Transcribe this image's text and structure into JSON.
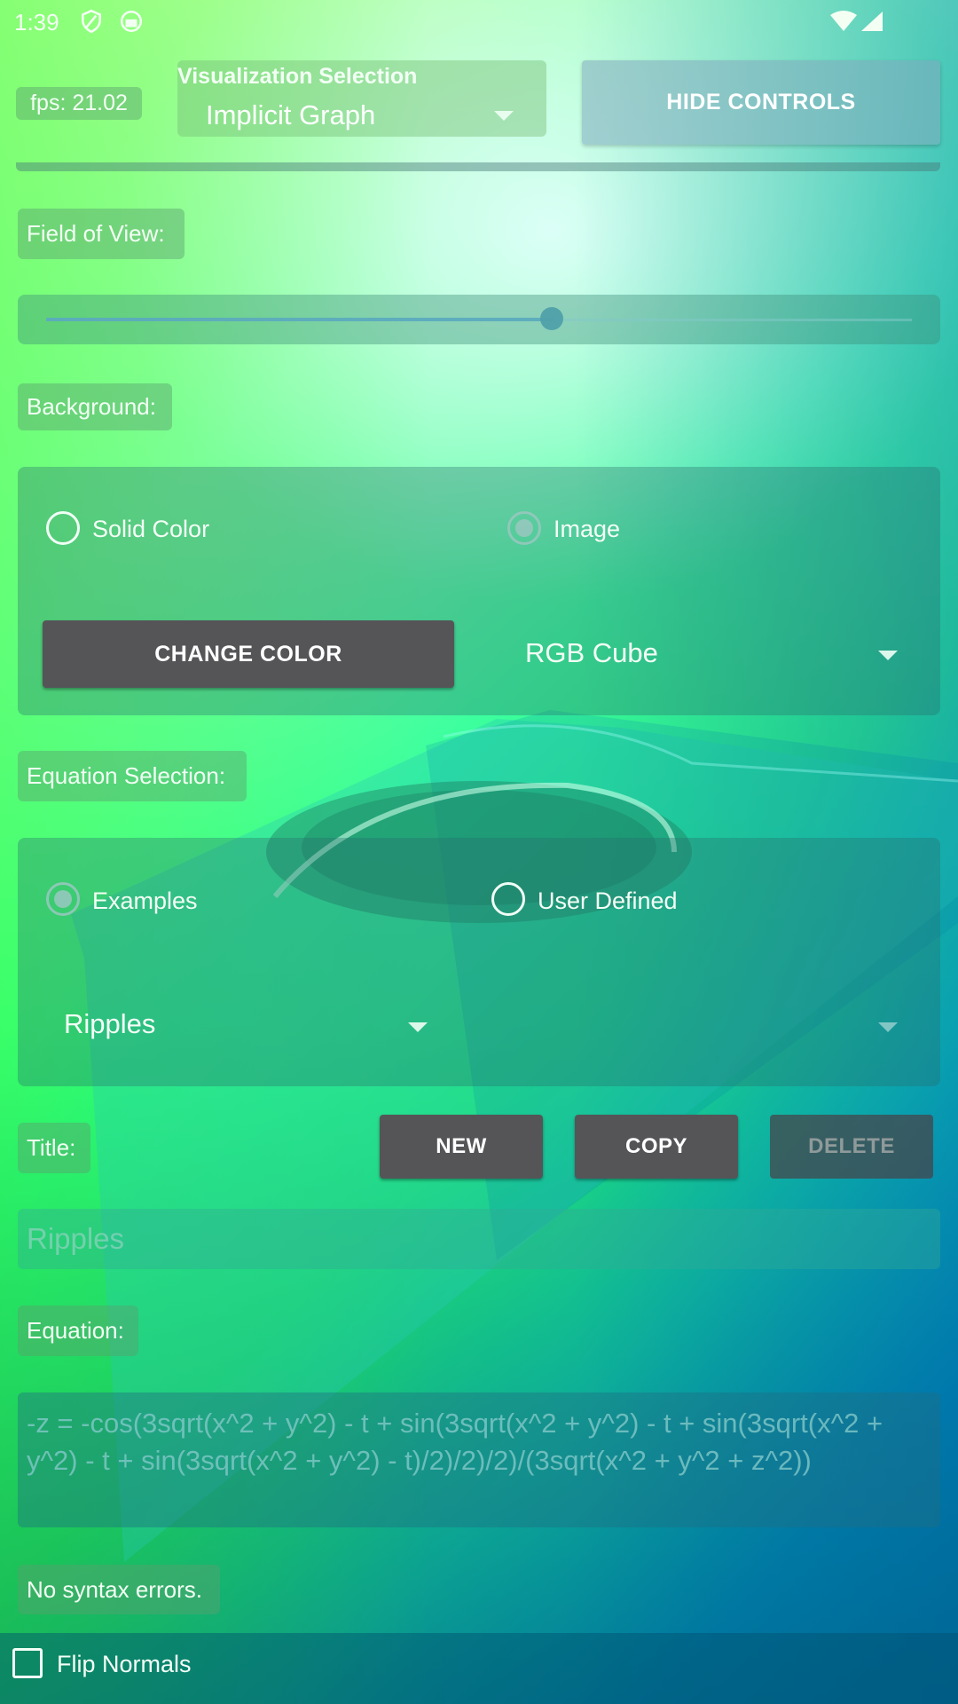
{
  "status_bar": {
    "time": "1:39"
  },
  "top_bar": {
    "fps_label": "fps: 21.02",
    "visualization_title": "Visualization Selection",
    "visualization_value": "Implicit Graph",
    "hide_controls_label": "HIDE CONTROLS"
  },
  "field_of_view": {
    "label": "Field of View:",
    "slider_fraction": 0.6
  },
  "background": {
    "label": "Background:",
    "radio_solid": "Solid Color",
    "radio_image": "Image",
    "selected": "Image",
    "change_color_label": "CHANGE COLOR",
    "image_dropdown_value": "RGB Cube"
  },
  "equation_selection": {
    "label": "Equation Selection:",
    "radio_examples": "Examples",
    "radio_user": "User Defined",
    "selected": "Examples",
    "example_dropdown_value": "Ripples"
  },
  "title_row": {
    "label": "Title:",
    "new_label": "NEW",
    "copy_label": "COPY",
    "delete_label": "DELETE",
    "title_value": "Ripples"
  },
  "equation": {
    "label": "Equation:",
    "text": "-z = -cos(3sqrt(x^2 + y^2) - t + sin(3sqrt(x^2 + y^2) - t + sin(3sqrt(x^2 + y^2) - t + sin(3sqrt(x^2 + y^2) - t)/2)/2)/2)/(3sqrt(x^2 + y^2 + z^2))"
  },
  "syntax_status": "No syntax errors.",
  "flip_normals": {
    "label": "Flip Normals",
    "checked": false
  },
  "icons": [
    "shield-icon",
    "face-icon",
    "wifi-icon",
    "signal-icon",
    "dropdown-arrow-icon",
    "checkbox-icon"
  ]
}
